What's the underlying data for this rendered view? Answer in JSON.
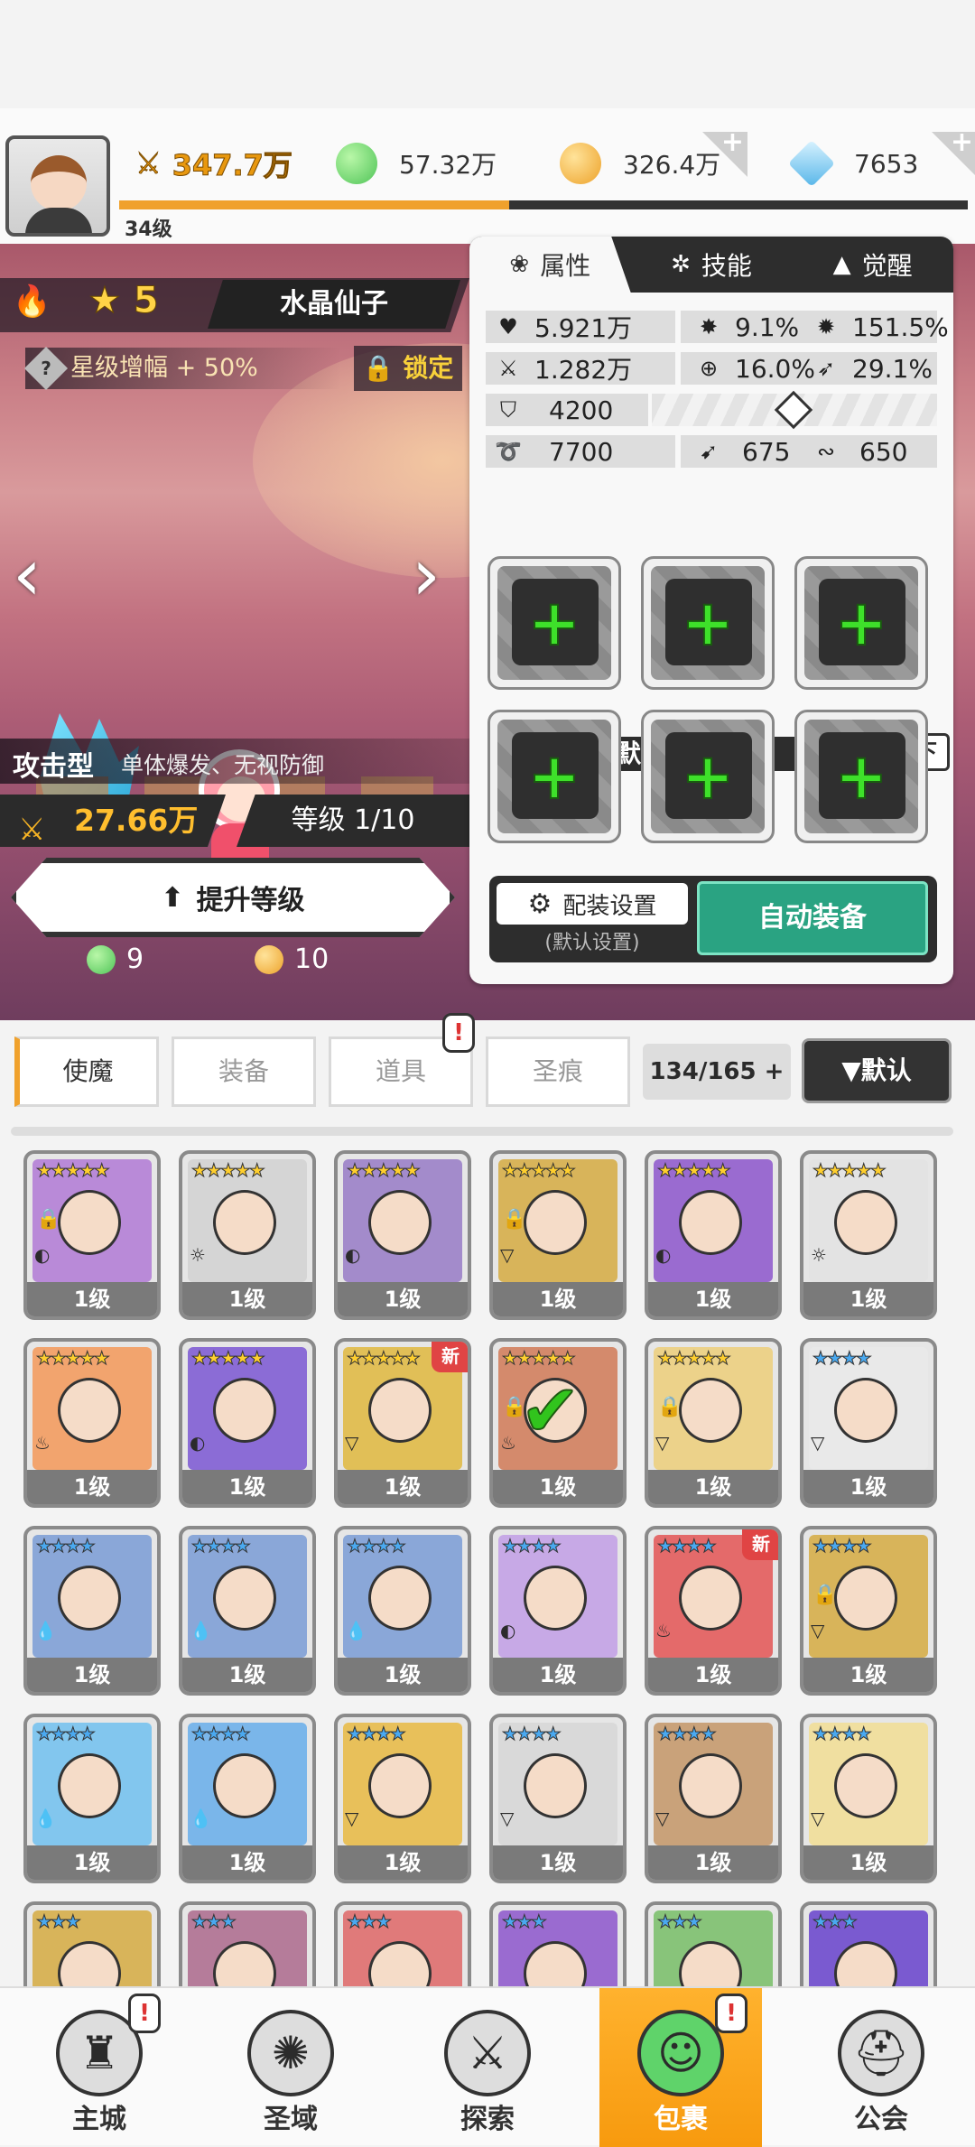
{
  "player": {
    "level": "34级",
    "power": "347.7万",
    "xp_fraction": 0.46
  },
  "resources": [
    {
      "name": "green-orb",
      "value": "57.32万",
      "color": "#5fd36a",
      "has_plus": false
    },
    {
      "name": "gold-coin",
      "value": "326.4万",
      "color": "#f5b232",
      "has_plus": true
    },
    {
      "name": "blue-gem",
      "value": "7653",
      "color": "#6cc7f0",
      "has_plus": true
    }
  ],
  "hero": {
    "stars": "5",
    "name": "水晶仙子",
    "star_boost": "星级增幅 + 50%",
    "lock": "锁定",
    "type": "攻击型",
    "type_desc": "单体爆发、无视防御",
    "power": "27.66万",
    "level_text": "等级 1/10",
    "upgrade": "提升等级",
    "cost_green": "9",
    "cost_gold": "10"
  },
  "panel": {
    "tabs": [
      "属性",
      "技能",
      "觉醒"
    ],
    "stats": {
      "hp": "5.921万",
      "crit": "9.1%",
      "crit_dmg": "151.5%",
      "atk": "1.282万",
      "hit": "16.0%",
      "dodge": "29.1%",
      "def": "4200",
      "v1": "7700",
      "v2": "675",
      "v3": "650"
    },
    "gear_set_name": "默认装备组",
    "unload_all": "全部卸下",
    "config": "配装设置",
    "config_sub": "(默认设置)",
    "auto_equip": "自动装备"
  },
  "bag_tabs": [
    "使魔",
    "装备",
    "道具",
    "圣痕"
  ],
  "count": "134/165",
  "sort": "▼默认",
  "cards": [
    {
      "stars": "★★★★★",
      "c": "#b98ad8",
      "level": "1级",
      "lock": true,
      "new": false,
      "check": false,
      "el": "◐"
    },
    {
      "stars": "★★★★★",
      "c": "#d5d5d5",
      "level": "1级",
      "lock": false,
      "new": false,
      "check": false,
      "el": "☼"
    },
    {
      "stars": "★★★★★",
      "c": "#a38bcb",
      "level": "1级",
      "lock": false,
      "new": false,
      "check": false,
      "el": "◐"
    },
    {
      "stars": "★★★★★",
      "c": "#d8b45a",
      "level": "1级",
      "lock": true,
      "new": false,
      "check": false,
      "el": "▽"
    },
    {
      "stars": "★★★★★",
      "c": "#9a6bd0",
      "level": "1级",
      "lock": false,
      "new": false,
      "check": false,
      "el": "◐"
    },
    {
      "stars": "★★★★★",
      "c": "#e3e3e3",
      "level": "1级",
      "lock": false,
      "new": false,
      "check": false,
      "el": "☼"
    },
    {
      "stars": "★★★★★",
      "c": "#f2a46e",
      "level": "1级",
      "lock": false,
      "new": false,
      "check": false,
      "el": "♨"
    },
    {
      "stars": "★★★★★",
      "c": "#8b6cd6",
      "level": "1级",
      "lock": false,
      "new": false,
      "check": false,
      "el": "◐"
    },
    {
      "stars": "★★★★★",
      "c": "#e1bf57",
      "level": "1级",
      "lock": false,
      "new": true,
      "check": false,
      "el": "▽"
    },
    {
      "stars": "★★★★★",
      "c": "#d48a6c",
      "level": "1级",
      "lock": true,
      "new": false,
      "check": true,
      "el": "♨"
    },
    {
      "stars": "★★★★★",
      "c": "#ecd28a",
      "level": "1级",
      "lock": true,
      "new": false,
      "check": false,
      "el": "▽"
    },
    {
      "stars": "★★★★",
      "c": "#e9e9e9",
      "level": "1级",
      "lock": false,
      "new": false,
      "check": false,
      "el": "▽"
    },
    {
      "stars": "★★★★",
      "c": "#8aa7d8",
      "level": "1级",
      "lock": false,
      "new": false,
      "check": false,
      "el": "💧"
    },
    {
      "stars": "★★★★",
      "c": "#8aa7d8",
      "level": "1级",
      "lock": false,
      "new": false,
      "check": false,
      "el": "💧"
    },
    {
      "stars": "★★★★",
      "c": "#8aa7d8",
      "level": "1级",
      "lock": false,
      "new": false,
      "check": false,
      "el": "💧"
    },
    {
      "stars": "★★★★",
      "c": "#c7a9e6",
      "level": "1级",
      "lock": false,
      "new": false,
      "check": false,
      "el": "◐"
    },
    {
      "stars": "★★★★",
      "c": "#e46a6a",
      "level": "1级",
      "lock": false,
      "new": true,
      "check": false,
      "el": "♨"
    },
    {
      "stars": "★★★★",
      "c": "#d8b45a",
      "level": "1级",
      "lock": true,
      "new": false,
      "check": false,
      "el": "▽"
    },
    {
      "stars": "★★★★",
      "c": "#82c6ee",
      "level": "1级",
      "lock": false,
      "new": false,
      "check": false,
      "el": "💧"
    },
    {
      "stars": "★★★★",
      "c": "#7ab6ea",
      "level": "1级",
      "lock": false,
      "new": false,
      "check": false,
      "el": "💧"
    },
    {
      "stars": "★★★★",
      "c": "#e8c05a",
      "level": "1级",
      "lock": false,
      "new": false,
      "check": false,
      "el": "▽"
    },
    {
      "stars": "★★★★",
      "c": "#d9d9d9",
      "level": "1级",
      "lock": false,
      "new": false,
      "check": false,
      "el": "▽"
    },
    {
      "stars": "★★★★",
      "c": "#c9a27a",
      "level": "1级",
      "lock": false,
      "new": false,
      "check": false,
      "el": "▽"
    },
    {
      "stars": "★★★★",
      "c": "#f0dfa0",
      "level": "1级",
      "lock": false,
      "new": false,
      "check": false,
      "el": "▽"
    },
    {
      "stars": "★★★",
      "c": "#d8b45a",
      "level": "",
      "lock": false,
      "new": false,
      "check": false,
      "el": ""
    },
    {
      "stars": "★★★",
      "c": "#b57c9a",
      "level": "",
      "lock": false,
      "new": false,
      "check": false,
      "el": ""
    },
    {
      "stars": "★★★",
      "c": "#e07a7a",
      "level": "",
      "lock": false,
      "new": false,
      "check": false,
      "el": ""
    },
    {
      "stars": "★★★",
      "c": "#9a6bd0",
      "level": "",
      "lock": false,
      "new": false,
      "check": false,
      "el": ""
    },
    {
      "stars": "★★★",
      "c": "#88c47a",
      "level": "",
      "lock": false,
      "new": false,
      "check": false,
      "el": ""
    },
    {
      "stars": "★★★",
      "c": "#7a5ad0",
      "level": "",
      "lock": false,
      "new": false,
      "check": false,
      "el": ""
    }
  ],
  "nav": [
    "主城",
    "圣域",
    "探索",
    "包裹",
    "公会"
  ],
  "nav_icons": [
    "castle-icon",
    "portal-icon",
    "sword-icon",
    "bag-icon",
    "helmet-icon"
  ],
  "colors": {
    "accent": "#f0a12c",
    "auto_equip": "#2aa382",
    "plus_green": "#3ee02a"
  }
}
